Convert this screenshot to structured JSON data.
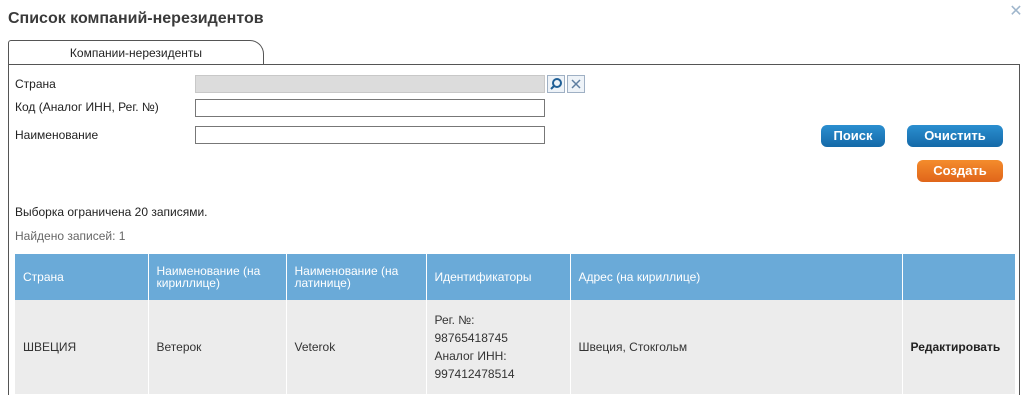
{
  "window": {
    "title": "Список компаний-нерезидентов",
    "close_icon": "close-icon"
  },
  "tabs": [
    {
      "label": "Компании-нерезиденты",
      "active": true
    }
  ],
  "filters": {
    "country_label": "Страна",
    "country_value": "",
    "code_label": "Код (Аналог ИНН, Рег. №)",
    "code_value": "",
    "name_label": "Наименование",
    "name_value": ""
  },
  "buttons": {
    "search": "Поиск",
    "clear": "Очистить",
    "create": "Создать"
  },
  "colors": {
    "primary_button": "#1a78bd",
    "create_button": "#ea7623",
    "table_header": "#6aaad8",
    "table_row": "#ececec"
  },
  "status": {
    "limit_note": "Выборка ограничена 20 записями.",
    "found": "Найдено записей: 1"
  },
  "table": {
    "columns": [
      "Страна",
      "Наименование (на кириллице)",
      "Наименование (на латинице)",
      "Идентификаторы",
      "Адрес (на кириллице)",
      ""
    ],
    "rows": [
      {
        "country": "ШВЕЦИЯ",
        "name_cyr": "Ветерок",
        "name_lat": "Veterok",
        "reg_label": "Рег. №:",
        "reg_value": "98765418745",
        "inn_label": "Аналог ИНН:",
        "inn_value": "997412478514",
        "address": "Швеция, Стокгольм",
        "action": "Редактировать"
      }
    ]
  }
}
